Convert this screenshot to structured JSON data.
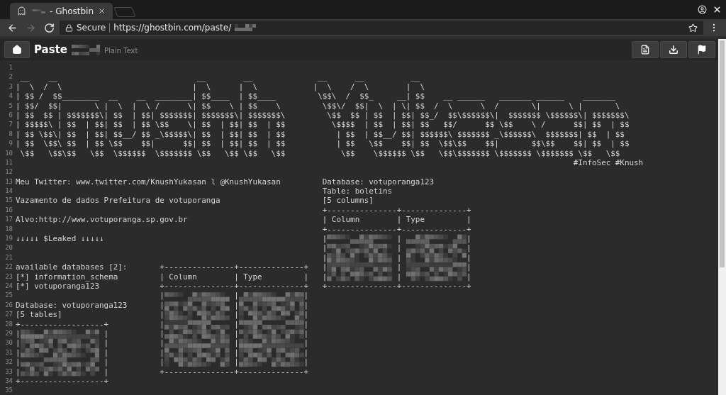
{
  "browser": {
    "tabs": [
      {
        "title": "- Ghostbin",
        "selected": true
      }
    ],
    "nav": [
      {
        "kind": "back",
        "disabled": false
      },
      {
        "kind": "forward",
        "disabled": true
      },
      {
        "kind": "reload",
        "disabled": false
      }
    ],
    "address": {
      "security": "Secure",
      "url": "https://ghostbin.com/paste/"
    }
  },
  "paste": {
    "title": "Paste",
    "syntax": "Plain Text"
  },
  "lines": [
    {
      "n": "1"
    },
    {
      "n": "2",
      "art_left": " __    __                              __        __",
      "art_right": " __      __          __"
    },
    {
      "n": "3",
      "art_left": "|  \\  /  \\                            |  \\      |  \\",
      "art_right": "|  \\    /  \\        |  \\"
    },
    {
      "n": "4",
      "art_left": "| $$ /  $$________  __    __  ________| $$____  | $$____",
      "art_right": " \\$$\\  /  $$_     __| $$    __ ______   _______ ______    _______"
    },
    {
      "n": "5",
      "art_left": "| $$/  $$|       \\ |  \\  |  \\ /      \\| $$    \\ | $$    \\",
      "art_right": "  \\$$\\/  $$|  \\  | \\| $$  /  \\      \\  /       \\|      \\ |       \\"
    },
    {
      "n": "6",
      "art_left": "| $$  $$ | $$$$$$$\\| $$  | $$| $$$$$$$| $$$$$$$\\| $$$$$$$\\",
      "art_right": "   \\$$  $$ | $$  | $$| $$_/  $$\\$$$$$$\\|  $$$$$$$ \\$$$$$$\\| $$$$$$$\\"
    },
    {
      "n": "7",
      "art_left": "| $$$$$\\ | $$  | $$| $$  | $$ \\$$    \\| $$  | $$| $$  | $$",
      "art_right": "    \\$$$$  | $$  | $$| $$   $$/      $$ \\$$    \\ /      $$| $$  | $$"
    },
    {
      "n": "8",
      "art_left": "| $$ \\$$\\| $$  | $$| $$__/ $$ _\\$$$$$\\| $$  | $$| $$  | $$",
      "art_right": "     | $$  | $$__/ $$| $$$$$$\\ $$$$$$$ _\\$$$$$$\\  $$$$$$$| $$  | $$"
    },
    {
      "n": "9",
      "art_left": "| $$  \\$$\\ $$  | $$ \\$$    $$|      $$| $$  | $$| $$  | $$",
      "art_right": "     | $$   \\$$    $$| $$  \\$$\\$$    $$|       $$\\$$    $$| $$  | $$"
    },
    {
      "n": "10",
      "art_left": " \\$$   \\$$\\$$   \\$$  \\$$$$$$  \\$$$$$$$ \\$$   \\$$ \\$$   \\$$",
      "art_right": "      \\$$    \\$$$$$$ \\$$   \\$$\\$$$$$$$ \\$$$$$$$ \\$$$$$$$ \\$$   \\$$"
    },
    {
      "n": "11",
      "hashtags": "#InfoSec #Knush"
    },
    {
      "n": "12"
    },
    {
      "n": "13",
      "left": "Meu Twitter: www.twitter.com/KnushYukasan l @KnushYukasan",
      "right": "Database: votuporanga123"
    },
    {
      "n": "14",
      "right": "Table: boletins"
    },
    {
      "n": "15",
      "left": "Vazamento de dados Prefeitura de votuporanga",
      "right": "[5 columns]"
    },
    {
      "n": "16",
      "right": "+---------------+--------------+"
    },
    {
      "n": "17",
      "left": "Alvo:http://www.votuporanga.sp.gov.br",
      "right": "| Column        | Type         |"
    },
    {
      "n": "18",
      "right": "+---------------+--------------+"
    },
    {
      "n": "19",
      "left": "↓↓↓↓↓ $Leaked ↓↓↓↓↓",
      "right": "|               |              |"
    },
    {
      "n": "20",
      "right": "|               |              |"
    },
    {
      "n": "21",
      "right": "|               |              |"
    },
    {
      "n": "22",
      "left": "available databases [2]:",
      "middle": "+---------------+--------------+",
      "right": "|               |              |"
    },
    {
      "n": "23",
      "left": "[*] information_schema",
      "middle": "| Column        | Type         |",
      "right": "|               |              |"
    },
    {
      "n": "24",
      "left": "[*] votuporanga123",
      "middle": "+---------------+--------------+",
      "right": "+---------------+--------------+"
    },
    {
      "n": "25",
      "middle": "|               |              |"
    },
    {
      "n": "26",
      "left": "Database: votuporanga123",
      "middle": "|               |              |"
    },
    {
      "n": "27",
      "left": "[5 tables]",
      "middle": "|               |              |"
    },
    {
      "n": "28",
      "left": "+------------------+",
      "middle": "|               |              |"
    },
    {
      "n": "29",
      "left": "|                  |",
      "middle": "|               |              |"
    },
    {
      "n": "30",
      "left": "|                  |",
      "middle": "|               |              |"
    },
    {
      "n": "31",
      "left": "|                  |",
      "middle": "|               |              |"
    },
    {
      "n": "32",
      "left": "|                  |",
      "middle": "|               |              |"
    },
    {
      "n": "33",
      "left": "|                  |",
      "middle": "+---------------+--------------+"
    },
    {
      "n": "34",
      "left": "+------------------+"
    },
    {
      "n": "35"
    }
  ]
}
